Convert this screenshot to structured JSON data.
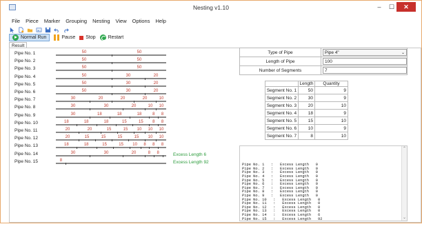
{
  "window": {
    "title": "Nesting v1.10",
    "controls": {
      "minimize": "–",
      "maximize": "☐",
      "close": "✕"
    }
  },
  "menu": [
    "File",
    "Piece",
    "Marker",
    "Grouping",
    "Nesting",
    "View",
    "Options",
    "Help"
  ],
  "toolbar": {
    "icons": [
      "pointer-icon",
      "new-icon",
      "open-folder-icon",
      "image-icon",
      "save-icon",
      "undo-icon",
      "redo-icon"
    ],
    "run_label": "Normal Run",
    "pause_label": "Pause",
    "stop_label": "Stop",
    "restart_label": "Restart"
  },
  "tab": {
    "label": "Result"
  },
  "pipes": [
    {
      "name": "Pipe No. 1",
      "segments": [
        50,
        50
      ],
      "excess": ""
    },
    {
      "name": "Pipe No. 2",
      "segments": [
        50,
        50
      ],
      "excess": ""
    },
    {
      "name": "Pipe No. 3",
      "segments": [
        50,
        50
      ],
      "excess": ""
    },
    {
      "name": "Pipe No. 4",
      "segments": [
        50,
        30,
        20
      ],
      "excess": ""
    },
    {
      "name": "Pipe No. 5",
      "segments": [
        50,
        30,
        20
      ],
      "excess": ""
    },
    {
      "name": "Pipe No. 6",
      "segments": [
        50,
        30,
        20
      ],
      "excess": ""
    },
    {
      "name": "Pipe No. 7",
      "segments": [
        30,
        20,
        20,
        20,
        10
      ],
      "excess": ""
    },
    {
      "name": "Pipe No. 8",
      "segments": [
        30,
        30,
        20,
        10,
        10
      ],
      "excess": ""
    },
    {
      "name": "Pipe No. 9",
      "segments": [
        30,
        18,
        18,
        18,
        8,
        8
      ],
      "excess": ""
    },
    {
      "name": "Pipe No. 10",
      "segments": [
        18,
        18,
        18,
        15,
        15,
        8,
        8
      ],
      "excess": ""
    },
    {
      "name": "Pipe No. 11",
      "segments": [
        20,
        20,
        15,
        15,
        10,
        10,
        10
      ],
      "excess": ""
    },
    {
      "name": "Pipe No. 12",
      "segments": [
        20,
        15,
        15,
        15,
        15,
        10,
        10
      ],
      "excess": ""
    },
    {
      "name": "Pipe No. 13",
      "segments": [
        18,
        18,
        15,
        15,
        10,
        8,
        8,
        8
      ],
      "excess": ""
    },
    {
      "name": "Pipe No. 14",
      "segments": [
        30,
        30,
        20,
        8,
        8
      ],
      "excess": "Excess Length 6"
    },
    {
      "name": "Pipe No. 15",
      "segments": [
        8
      ],
      "excess": "Excess Length 92"
    }
  ],
  "form": {
    "type_label": "Type of Pipe",
    "type_value": "Pipe 4\"",
    "length_label": "Length of Pipe",
    "length_value": "100",
    "segments_label": "Number of Segments",
    "segments_value": "7"
  },
  "segment_table": {
    "headers": [
      "",
      "Length",
      "Quantity"
    ],
    "rows": [
      {
        "name": "Segment No. 1",
        "length": "50",
        "qty": "9"
      },
      {
        "name": "Segment No. 2",
        "length": "30",
        "qty": "9"
      },
      {
        "name": "Segment No. 3",
        "length": "20",
        "qty": "10"
      },
      {
        "name": "Segment No. 4",
        "length": "18",
        "qty": "9"
      },
      {
        "name": "Segment No. 5",
        "length": "15",
        "qty": "10"
      },
      {
        "name": "Segment No. 6",
        "length": "10",
        "qty": "9"
      },
      {
        "name": "Segment No. 7",
        "length": "8",
        "qty": "10"
      }
    ]
  },
  "log": [
    "Pipe No. 1   :   Excess Length   0",
    "Pipe No. 2   :   Excess Length   0",
    "Pipe No. 3   :   Excess Length   0",
    "Pipe No. 4   :   Excess Length   0",
    "Pipe No. 5   :   Excess Length   0",
    "Pipe No. 6   :   Excess Length   0",
    "Pipe No. 7   :   Excess Length   0",
    "Pipe No. 8   :   Excess Length   0",
    "Pipe No. 9   :   Excess Length   0",
    "Pipe No. 10   :   Excess Length   0",
    "Pipe No. 11   :   Excess Length   0",
    "Pipe No. 12   :   Excess Length   0",
    "Pipe No. 13   :   Excess Length   0",
    "Pipe No. 14   :   Excess Length   6",
    "Pipe No. 15   :   Excess Length   92"
  ]
}
